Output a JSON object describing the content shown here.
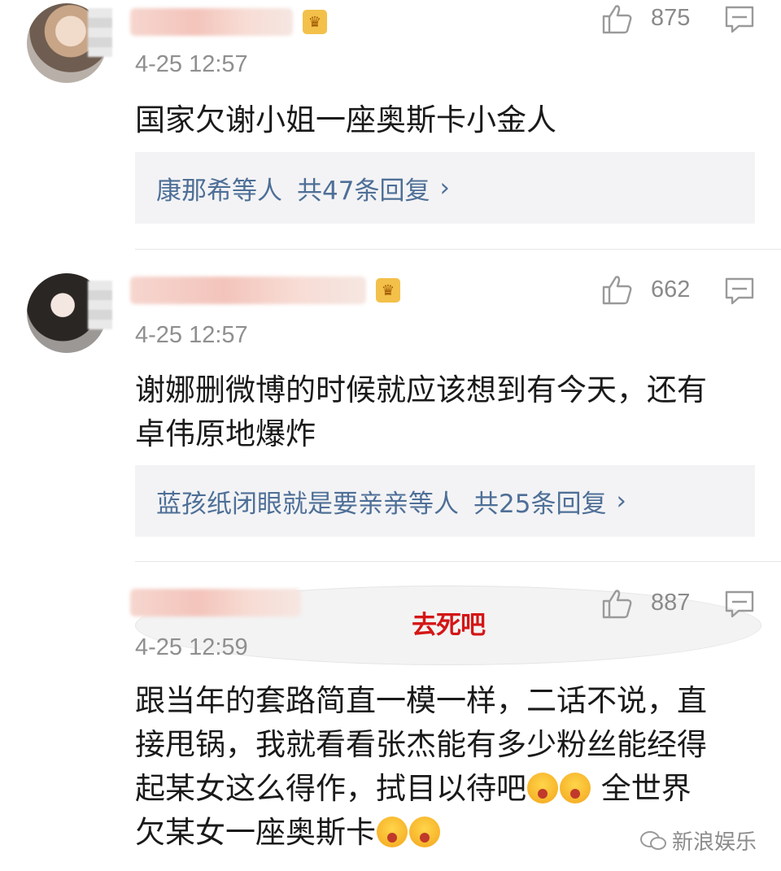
{
  "comments": [
    {
      "avatar_type": "photo",
      "time": "4-25 12:57",
      "likes": "875",
      "text": "国家欠谢小姐一座奥斯卡小金人",
      "reply_users": "康那希等人",
      "reply_count": "共47条回复"
    },
    {
      "avatar_type": "photo",
      "time": "4-25 12:57",
      "likes": "662",
      "text_line1": "谢娜删微博的时候就应该想到有今天，还有",
      "text_line2": "卓伟原地爆炸",
      "reply_users": "蓝孩纸闭眼就是要亲亲等人",
      "reply_count": "共25条回复"
    },
    {
      "avatar_text": "去死吧",
      "time": "4-25 12:59",
      "likes": "887",
      "line1": "跟当年的套路简直一模一样，二话不说，直",
      "line2": "接甩锅，我就看看张杰能有多少粉丝能经得",
      "line3a": "起某女这么得作，拭目以待吧",
      "line3b": "全世界",
      "line4": "欠某女一座奥斯卡"
    }
  ],
  "reply_chevron": "›",
  "watermark": "新浪娱乐",
  "icons": {
    "like": "thumbs-up-icon",
    "reply": "comment-bubble-icon",
    "vip": "vip-badge-icon",
    "emoji_crying": "crying-face-emoji",
    "emoji_smile": "smiling-face-emoji"
  },
  "colors": {
    "link_blue": "#4e6f97",
    "reply_bg": "#f3f3f5",
    "time_gray": "#8f8f8f",
    "avatar_text_red": "#d41616"
  }
}
